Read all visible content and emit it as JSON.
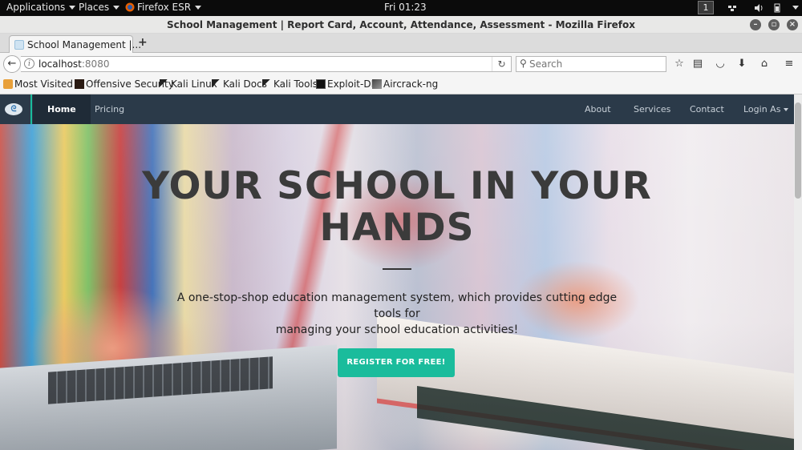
{
  "system_bar": {
    "applications": "Applications",
    "places": "Places",
    "app": "Firefox ESR",
    "clock": "Fri 01:23",
    "workspace": "1"
  },
  "window": {
    "title": "School Management | Report Card, Account, Attendance, Assessment - Mozilla Firefox"
  },
  "tabs": [
    {
      "label": "School Management |..."
    }
  ],
  "navigation": {
    "url_host": "localhost",
    "url_port": ":8080",
    "search_placeholder": "Search"
  },
  "bookmarks": [
    {
      "label": "Most Visited ▾",
      "icon": "star-folder-icon"
    },
    {
      "label": "Offensive Security",
      "icon": "offsec-icon"
    },
    {
      "label": "Kali Linux",
      "icon": "kali-icon"
    },
    {
      "label": "Kali Docs",
      "icon": "kali-icon"
    },
    {
      "label": "Kali Tools",
      "icon": "kali-icon"
    },
    {
      "label": "Exploit-DB",
      "icon": "exploitdb-icon"
    },
    {
      "label": "Aircrack-ng",
      "icon": "aircrack-icon"
    }
  ],
  "site_nav": {
    "left": [
      "Home",
      "Pricing"
    ],
    "right": [
      "About",
      "Services",
      "Contact",
      "Login As"
    ],
    "active": "Home"
  },
  "hero": {
    "headline_1": "YOUR SCHOOL IN YOUR",
    "headline_2": "HANDS",
    "tagline_1": "A one-stop-shop education management system, which provides cutting edge tools for",
    "tagline_2": "managing your school education activities!",
    "cta": "REGISTER FOR FREE!"
  },
  "colors": {
    "nav_bg": "#2b3a49",
    "accent": "#1abc9c"
  }
}
